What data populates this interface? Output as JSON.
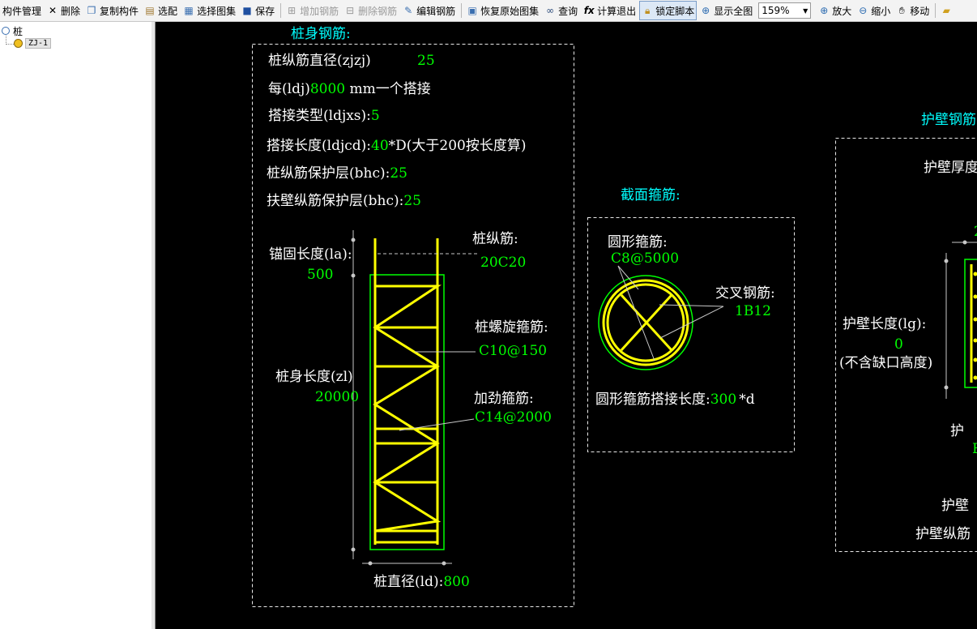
{
  "toolbar": {
    "component_manager": "构件管理",
    "delete": "删除",
    "copy_component": "复制构件",
    "select_match": "选配",
    "select_atlas": "选择图集",
    "save": "保存",
    "add_rebar": "增加钢筋",
    "delete_rebar": "删除钢筋",
    "edit_rebar": "编辑钢筋",
    "restore_atlas": "恢复原始图集",
    "query": "查询",
    "calc_exit": "计算退出",
    "lock_script": "锁定脚本",
    "show_all": "显示全图",
    "zoom_level": "159%",
    "zoom_in": "放大",
    "zoom_out": "缩小",
    "move": "移动"
  },
  "tree": {
    "root_label": "桩",
    "child_label": "ZJ-1"
  },
  "drawing": {
    "pile_body": {
      "title": "桩身钢筋:",
      "p_diameter": {
        "label": "桩纵筋直径(zjzj)",
        "value": "25"
      },
      "p_splice": {
        "prefix": "每(ldj)",
        "value": "8000",
        "suffix": " mm一个搭接"
      },
      "p_splice_type": {
        "label": "搭接类型(ldjxs):",
        "value": "5"
      },
      "p_splice_len": {
        "label": "搭接长度(ldjcd):",
        "value": "40",
        "suffix": "*D(大于200按长度算)"
      },
      "p_cover": {
        "label": "桩纵筋保护层(bhc):",
        "value": "25"
      },
      "p_wall_cover": {
        "label": "扶壁纵筋保护层(bhc):",
        "value": "25"
      },
      "anchor": {
        "label": "锚固长度(la):",
        "value": "500"
      },
      "body_len": {
        "label": "桩身长度(zl)",
        "value": "20000"
      },
      "long_bar": {
        "label": "桩纵筋:",
        "value": "20C20"
      },
      "spiral": {
        "label": "桩螺旋箍筋:",
        "value": "C10@150"
      },
      "stiff": {
        "label": "加劲箍筋:",
        "value": "C14@2000"
      },
      "pile_dia": {
        "label": "桩直径(ld):",
        "value": "800"
      }
    },
    "section": {
      "title": "截面箍筋:",
      "circ_stirrup": {
        "label": "圆形箍筋:",
        "value": "C8@5000"
      },
      "cross": {
        "label": "交叉钢筋:",
        "value": "1B12"
      },
      "circ_overlap": {
        "label": "圆形箍筋搭接长度:",
        "value": "300",
        "suffix": "*d"
      }
    },
    "wall": {
      "title": "护壁钢筋",
      "thickness_label": "护壁厚度",
      "length": {
        "label": "护壁长度(lg):",
        "value": "0",
        "note": "(不含缺口高度)"
      },
      "label_a": "护",
      "label_b": "护壁",
      "label_c": "护壁纵筋",
      "green_partial_a": "2",
      "green_partial_b": "E"
    }
  },
  "colors": {
    "canvas_bg": "#000000",
    "text": "#ffffff",
    "value": "#00ff00",
    "title": "#00ffff",
    "rebar": "#ffff00",
    "outline": "#00ff00",
    "leader": "#c0c0c0"
  }
}
